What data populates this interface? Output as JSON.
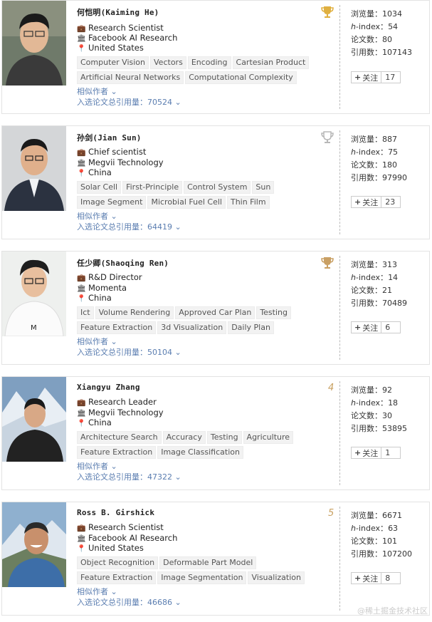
{
  "authors": [
    {
      "name": "何恺明(Kaiming He)",
      "position": "Research Scientist",
      "org": "Facebook AI Research",
      "country": "United States",
      "tags_row1": [
        "Computer Vision",
        "Vectors",
        "Encoding",
        "Cartesian Product"
      ],
      "tags_row2": [
        "Artificial Neural Networks",
        "Computational Complexity"
      ],
      "similar": "相似作者",
      "cited": "入选论文总引用量：70524",
      "rank": "",
      "badge": "gold",
      "stats": {
        "views_label": "浏览量：",
        "views": "1034",
        "h_label": "h",
        "h_suffix": "-index：",
        "h": "54",
        "papers_label": "论文数：",
        "papers": "80",
        "cites_label": "引用数：",
        "cites": "107143"
      },
      "follow_label": "关注",
      "follow_count": "17"
    },
    {
      "name": "孙剑(Jian Sun)",
      "position": "Chief scientist",
      "org": "Megvii Technology",
      "country": "China",
      "tags_row1": [
        "Solar Cell",
        "First-Principle",
        "Control System",
        "Sun"
      ],
      "tags_row2": [
        "Image Segment",
        "Microbial Fuel Cell",
        "Thin Film"
      ],
      "similar": "相似作者",
      "cited": "入选论文总引用量：64419",
      "rank": "",
      "badge": "silver",
      "stats": {
        "views_label": "浏览量：",
        "views": "887",
        "h_label": "h",
        "h_suffix": "-index：",
        "h": "75",
        "papers_label": "论文数：",
        "papers": "180",
        "cites_label": "引用数：",
        "cites": "97990"
      },
      "follow_label": "关注",
      "follow_count": "23"
    },
    {
      "name": "任少卿(Shaoqing Ren)",
      "position": "R&D Director",
      "org": "Momenta",
      "country": "China",
      "tags_row1": [
        "Ict",
        "Volume Rendering",
        "Approved Car Plan",
        "Testing"
      ],
      "tags_row2": [
        "Feature Extraction",
        "3d Visualization",
        "Daily Plan"
      ],
      "similar": "相似作者",
      "cited": "入选论文总引用量：50104",
      "rank": "",
      "badge": "bronze",
      "stats": {
        "views_label": "浏览量：",
        "views": "313",
        "h_label": "h",
        "h_suffix": "-index：",
        "h": "14",
        "papers_label": "论文数：",
        "papers": "21",
        "cites_label": "引用数：",
        "cites": "70489"
      },
      "follow_label": "关注",
      "follow_count": "6"
    },
    {
      "name": "Xiangyu Zhang",
      "position": "Research Leader",
      "org": "Megvii Technology",
      "country": "China",
      "tags_row1": [
        "Architecture Search",
        "Accuracy",
        "Testing",
        "Agriculture"
      ],
      "tags_row2": [
        "Feature Extraction",
        "Image Classification"
      ],
      "similar": "相似作者",
      "cited": "入选论文总引用量：47322",
      "rank": "4",
      "badge": "",
      "stats": {
        "views_label": "浏览量：",
        "views": "92",
        "h_label": "h",
        "h_suffix": "-index：",
        "h": "18",
        "papers_label": "论文数：",
        "papers": "30",
        "cites_label": "引用数：",
        "cites": "53895"
      },
      "follow_label": "关注",
      "follow_count": "1"
    },
    {
      "name": "Ross B. Girshick",
      "position": "Research Scientist",
      "org": "Facebook AI Research",
      "country": "United States",
      "tags_row1": [
        "Object Recognition",
        "Deformable Part Model"
      ],
      "tags_row2": [
        "Feature Extraction",
        "Image Segmentation",
        "Visualization"
      ],
      "similar": "相似作者",
      "cited": "入选论文总引用量：46686",
      "rank": "5",
      "badge": "",
      "stats": {
        "views_label": "浏览量：",
        "views": "6671",
        "h_label": "h",
        "h_suffix": "-index：",
        "h": "63",
        "papers_label": "论文数：",
        "papers": "101",
        "cites_label": "引用数：",
        "cites": "107200"
      },
      "follow_label": "关注",
      "follow_count": "8"
    }
  ],
  "watermark": "@稀土掘金技术社区",
  "colors": {
    "link": "#5a7db0",
    "gold": "#e0b040",
    "silver": "#b8b8b8",
    "bronze": "#c9a064"
  }
}
